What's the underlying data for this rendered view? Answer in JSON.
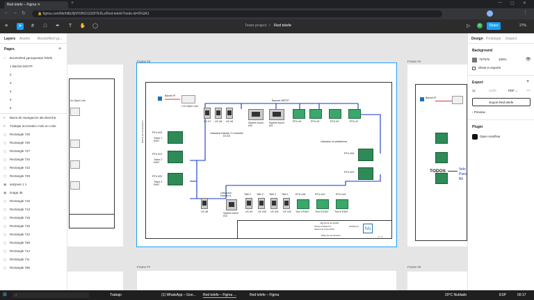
{
  "browser": {
    "tab_title": "Red telefe – Figma",
    "url": "figma.com/file/h8b2ljNY0lNCGSDf7E6Ls/Red-telefe?node-id=0%3A1"
  },
  "figma": {
    "project": "Team project",
    "file": "Red telefe",
    "share": "Share",
    "zoom": "27%",
    "avatar": "R"
  },
  "left_panel": {
    "tabs": [
      "Layers",
      "Assets",
      "BocetoRed yp..."
    ],
    "pages_title": "Pages",
    "pages": [
      "BocetoRed yproquestas Telefe",
      "1 Bachet MSITP",
      "2",
      "3",
      "4",
      "5",
      "6"
    ],
    "layers": [
      "Barra de navegacion ala derecha",
      "Trabajar acromatico más un color",
      "Rectangle 729",
      "Rectangle 725",
      "Rectangle 727",
      "Rectangle 734",
      "Rectangle 723",
      "Rectangle 728",
      "andyvas 1 1",
      "image 36",
      "Rectangle 716",
      "Rectangle 713",
      "Rectangle 718",
      "Rectangle 715",
      "Rectangle 712",
      "Rectangle 769",
      "Rectangle 714",
      "Rectangle 711",
      "Rectangle 786"
    ]
  },
  "canvas": {
    "frames": [
      "Frame #3",
      "Frame #4",
      "Frame #7",
      "Frame #8"
    ],
    "diagram": {
      "bus_title": "Bacnet MSTP",
      "bacnet_ip": "Bacnet IP",
      "top_devices": [
        "UC #7",
        "UC #6",
        "UC #5",
        "System touch #10",
        "System touch #11",
        "RTU #4",
        "RTU #3",
        "RTU #2",
        "RTU #1"
      ],
      "ivu_label": "I-Vu Open Link",
      "left_rtus": [
        "RTU #22",
        "RTU #21",
        "RTU #20"
      ],
      "left_captions": [
        "Trane 1 E467",
        "Trane 2 E467",
        "Trane 3 E467"
      ],
      "ubic_top": "Ubicados Estudio 3 Controller E3 E5",
      "ubic_plat": "Ubicados en plataforma",
      "right_rtus": [
        "RTU #24",
        "RTU #23"
      ],
      "bottom_top": [
        "Ubicacion Estudio 6",
        "TAB 2",
        "TAB 2",
        "TAB 3",
        "TAB 1",
        "RTU #18",
        "RTU #19",
        "RTU #14"
      ],
      "bottom_devices": [
        "UC #8",
        "System touch #12",
        "UC #9",
        "UC #10",
        "UC #11",
        "UC #12",
        "Trox 4 E467",
        "Trox 5 E467",
        "Trox 6 E467"
      ],
      "side_text": "Planos de comunicacion",
      "title_block": {
        "company": "Ingeniería de detalle",
        "rows": [
          "Telecom Federal S.S.",
          "Sistema de control HVAC",
          "Red Bacnet",
          "Redes de comunicacion"
        ],
        "sheet": "2 - 4"
      }
    },
    "right_frame": {
      "bacnet_ip": "Bacnet IP",
      "todos": "TODOS",
      "trunc": [
        "Velo",
        "Panc",
        "Bit"
      ]
    }
  },
  "right_panel": {
    "tabs": [
      "Design",
      "Prototype",
      "Inspect"
    ],
    "background_title": "Background",
    "bg_hex": "757575",
    "bg_opacity": "100%",
    "show_exports": "Show in exports",
    "export_title": "Export",
    "export_scale": "1x",
    "export_suffix": "Suffix",
    "export_format": "PDF",
    "export_button": "Export Red telefe",
    "preview": "Preview",
    "plugin_title": "Plugin",
    "plugin_name": "Open Autoflow"
  },
  "taskbar": {
    "items": [
      "Trabajo",
      "(1) WhatsApp – Goo...",
      "Red telefe – Figma ...",
      "Red telefe – Figma"
    ],
    "weather": "20°C Nublado",
    "lang": "ESP",
    "time": "00:17"
  }
}
